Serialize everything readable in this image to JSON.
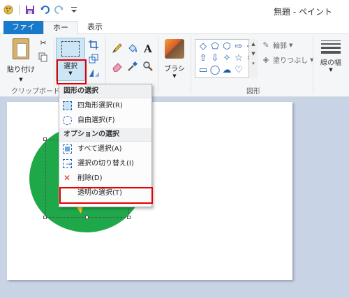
{
  "window": {
    "title": "無題 - ペイント"
  },
  "quick_access": {
    "icons": [
      "paint-app-icon",
      "save-icon",
      "undo-icon",
      "redo-icon",
      "customize-qat-icon"
    ]
  },
  "ribbon": {
    "tabs": [
      {
        "label": "ファイル",
        "active": false
      },
      {
        "label": "ホーム",
        "active": true
      },
      {
        "label": "表示",
        "active": false
      }
    ],
    "groups": {
      "clipboard": {
        "label": "クリップボード",
        "paste_label": "貼り付け"
      },
      "image": {
        "select_label": "選択"
      },
      "tools": {},
      "brushes": {
        "label": "ブラシ"
      },
      "shapes": {
        "label": "図形",
        "outline_label": "輪郭",
        "fill_label": "塗りつぶし"
      },
      "size": {
        "label": "線の幅"
      }
    }
  },
  "select_menu": {
    "sections": [
      {
        "header": "図形の選択",
        "items": [
          {
            "label": "四角形選択(R)",
            "icon": "rectangular-selection-icon"
          },
          {
            "label": "自由選択(F)",
            "icon": "free-form-selection-icon"
          }
        ]
      },
      {
        "header": "オプションの選択",
        "items": [
          {
            "label": "すべて選択(A)",
            "icon": "select-all-icon"
          },
          {
            "label": "選択の切り替え(I)",
            "icon": "invert-selection-icon"
          },
          {
            "label": "削除(D)",
            "icon": "delete-icon"
          },
          {
            "label": "透明の選択(T)",
            "icon": "transparent-selection-icon",
            "highlighted": true
          }
        ]
      }
    ]
  },
  "colors": {
    "file_tab": "#1979ca",
    "highlight": "#e30000",
    "circle": "#1fa84a",
    "star": "#f7c21b"
  }
}
